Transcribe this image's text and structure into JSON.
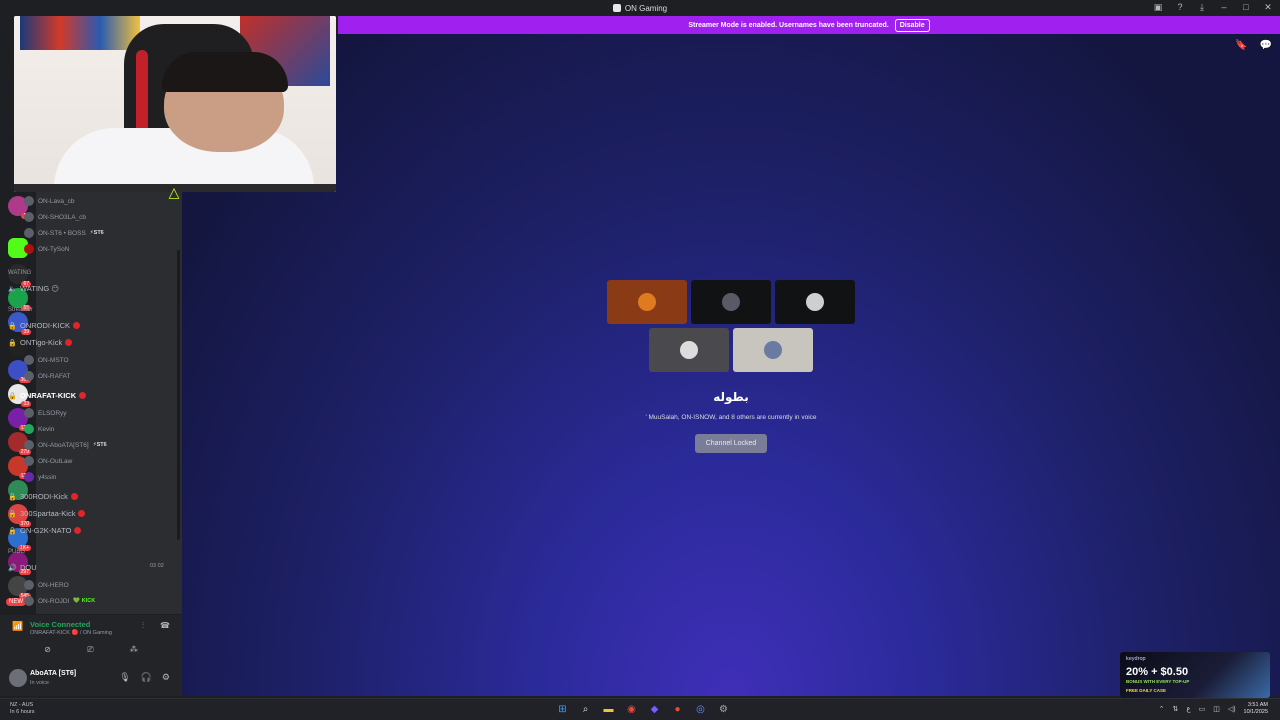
{
  "window": {
    "title": "ON Gaming"
  },
  "banner": {
    "text": "Streamer Mode is enabled. Usernames have been truncated.",
    "button": "Disable"
  },
  "servers": {
    "badges": [
      "10",
      "67",
      "55",
      "39",
      "363",
      "33",
      "128",
      "279",
      "129",
      "370",
      "1K+",
      "297",
      "545"
    ],
    "new_label": "NEW"
  },
  "channels": {
    "top_users": [
      {
        "name": "ON-Lava_cb"
      },
      {
        "name": "ON-SHO3LA_cb"
      },
      {
        "name": "ON-ST6 • BOSS",
        "tag": "⚡ST6"
      },
      {
        "name": "ON-TySoN"
      }
    ],
    "cat_waiting": "WATING",
    "ch_waiting": "WATING 😶",
    "cat_streamer": "Streamer",
    "ch_onrodi": "ONRODI-KICK",
    "ch_ontigo": "ONTigo-Kick",
    "ontigo_users": [
      "ON-MSTO",
      "ON-RAFAT"
    ],
    "ch_onrafat": "ONRAFAT-KICK",
    "onrafat_users": [
      {
        "name": "ELSORyy"
      },
      {
        "name": "Kevin"
      },
      {
        "name": "ON-AboATA[ST6]",
        "tag": "⚡ST6"
      },
      {
        "name": "ON-OutLaw"
      },
      {
        "name": "y4ssin"
      }
    ],
    "ch_300rodi": "300RODI-Kick",
    "ch_300spartaa": "300Spartaa-Kick",
    "ch_g2k": "ON-G2K-NATO",
    "cat_pubg": "PUBG",
    "ch_dou": "DOU",
    "dou_counts": "03 02",
    "dou_users": [
      {
        "name": "ON-HERO"
      },
      {
        "name": "ON-ROJDI",
        "tag": "💚 KICK"
      }
    ]
  },
  "voice": {
    "status": "Voice Connected",
    "location": "ONRAFAT-KICK 🔴 / ON Gaming"
  },
  "user": {
    "name": "AboATA [ST6]",
    "status": "In voice"
  },
  "main": {
    "title": "بطوله",
    "in_voice": "' MuuSalah, ON-ISNOW, and 8 others are currently in voice",
    "lock_button": "Channel Locked"
  },
  "ad": {
    "brand": "keydrop",
    "headline": "20% + $0.50",
    "sub": "BONUS WITH EVERY TOP-UP",
    "foot": "FREE DAILY CASE"
  },
  "taskbar": {
    "weather": "NZ - AUS",
    "weather_sub": "In 6 hours",
    "time": "3:51 AM",
    "date": "10/1/2025"
  },
  "colors": {
    "banner": "#a020f0",
    "voice_green": "#23a55a",
    "live_red": "#e0252b",
    "accent_neon": "#c6ff1a"
  }
}
